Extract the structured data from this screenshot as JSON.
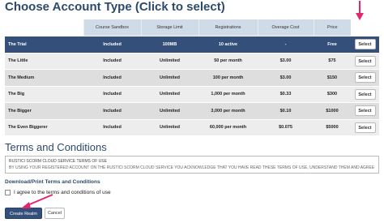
{
  "page_title": "Choose Account Type (Click to select)",
  "table": {
    "headers": [
      "Course Sandbox",
      "Storage Limit",
      "Registrations",
      "Overage Cost",
      "Price"
    ],
    "rows": [
      {
        "name": "The Trial",
        "sandbox": "Included",
        "storage": "100MB",
        "registrations": "10 active",
        "overage": "-",
        "price": "Free",
        "button": "Select",
        "selected": true
      },
      {
        "name": "The Little",
        "sandbox": "Included",
        "storage": "Unlimited",
        "registrations": "50 per month",
        "overage": "$3.00",
        "price": "$75",
        "button": "Select",
        "selected": false
      },
      {
        "name": "The Medium",
        "sandbox": "Included",
        "storage": "Unlimited",
        "registrations": "100 per month",
        "overage": "$3.00",
        "price": "$150",
        "button": "Select",
        "selected": false
      },
      {
        "name": "The Big",
        "sandbox": "Included",
        "storage": "Unlimited",
        "registrations": "1,000 per month",
        "overage": "$0.33",
        "price": "$300",
        "button": "Select",
        "selected": false
      },
      {
        "name": "The Bigger",
        "sandbox": "Included",
        "storage": "Unlimited",
        "registrations": "3,000 per month",
        "overage": "$0.10",
        "price": "$1000",
        "button": "Select",
        "selected": false
      },
      {
        "name": "The Even Biggerer",
        "sandbox": "Included",
        "storage": "Unlimited",
        "registrations": "60,000 per month",
        "overage": "$0.075",
        "price": "$5000",
        "button": "Select",
        "selected": false
      }
    ]
  },
  "terms": {
    "title": "Terms and Conditions",
    "text_line1": "RUSTICI SCORM CLOUD SERVICE TERMS OF USE",
    "text_line2": "BY USING YOUR REGISTERED ACCOUNT ON THE RUSTICI SCORM CLOUD SERVICE YOU ACKNOWLEDGE THAT YOU HAVE READ THESE TERMS OF USE, UNDERSTAND THEM AND AGREE TO BE",
    "download_link": "Download/Print Terms and Conditions",
    "agree_label": "I agree to the terms and conditions of use"
  },
  "actions": {
    "create_label": "Create Realm",
    "cancel_label": "Cancel"
  },
  "colors": {
    "accent": "#34507a",
    "header_bg": "#cfdbe6",
    "arrow": "#e2266e"
  }
}
